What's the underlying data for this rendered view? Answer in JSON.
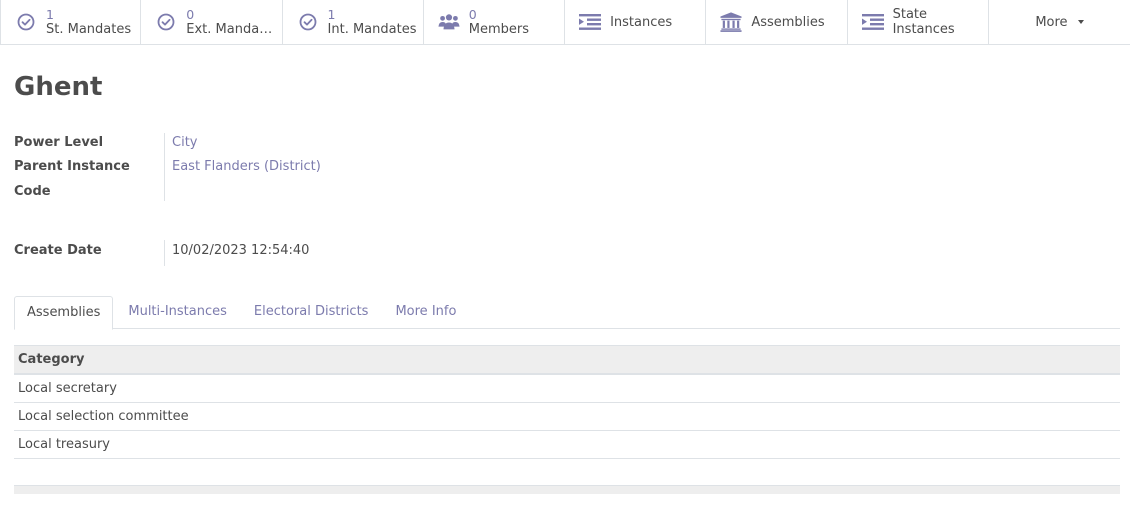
{
  "smart_buttons": [
    {
      "count": "1",
      "label": "St. Mandates",
      "icon": "check-circle-icon"
    },
    {
      "count": "0",
      "label": "Ext. Mandates",
      "icon": "check-circle-icon"
    },
    {
      "count": "1",
      "label": "Int. Mandates",
      "icon": "check-circle-icon"
    },
    {
      "count": "0",
      "label": "Members",
      "icon": "users-icon"
    },
    {
      "label": "Instances",
      "icon": "indent-list-icon"
    },
    {
      "label": "Assemblies",
      "icon": "institution-icon"
    },
    {
      "label_line1": "State",
      "label_line2": "Instances",
      "icon": "indent-list-icon"
    }
  ],
  "more_label": "More",
  "title": "Ghent",
  "fields": {
    "power_level": {
      "label": "Power Level",
      "value": "City"
    },
    "parent_instance": {
      "label": "Parent Instance",
      "value": "East Flanders (District)"
    },
    "code": {
      "label": "Code",
      "value": ""
    },
    "create_date": {
      "label": "Create Date",
      "value": "10/02/2023 12:54:40"
    }
  },
  "tabs": [
    {
      "label": "Assemblies",
      "active": true
    },
    {
      "label": "Multi-Instances",
      "active": false
    },
    {
      "label": "Electoral Districts",
      "active": false
    },
    {
      "label": "More Info",
      "active": false
    }
  ],
  "table": {
    "header": "Category",
    "rows": [
      "Local secretary",
      "Local selection committee",
      "Local treasury"
    ]
  },
  "colors": {
    "accent": "#7c7bad",
    "text": "#4c4c4c",
    "border": "#dee2e6",
    "header_bg": "#eeeeee"
  }
}
